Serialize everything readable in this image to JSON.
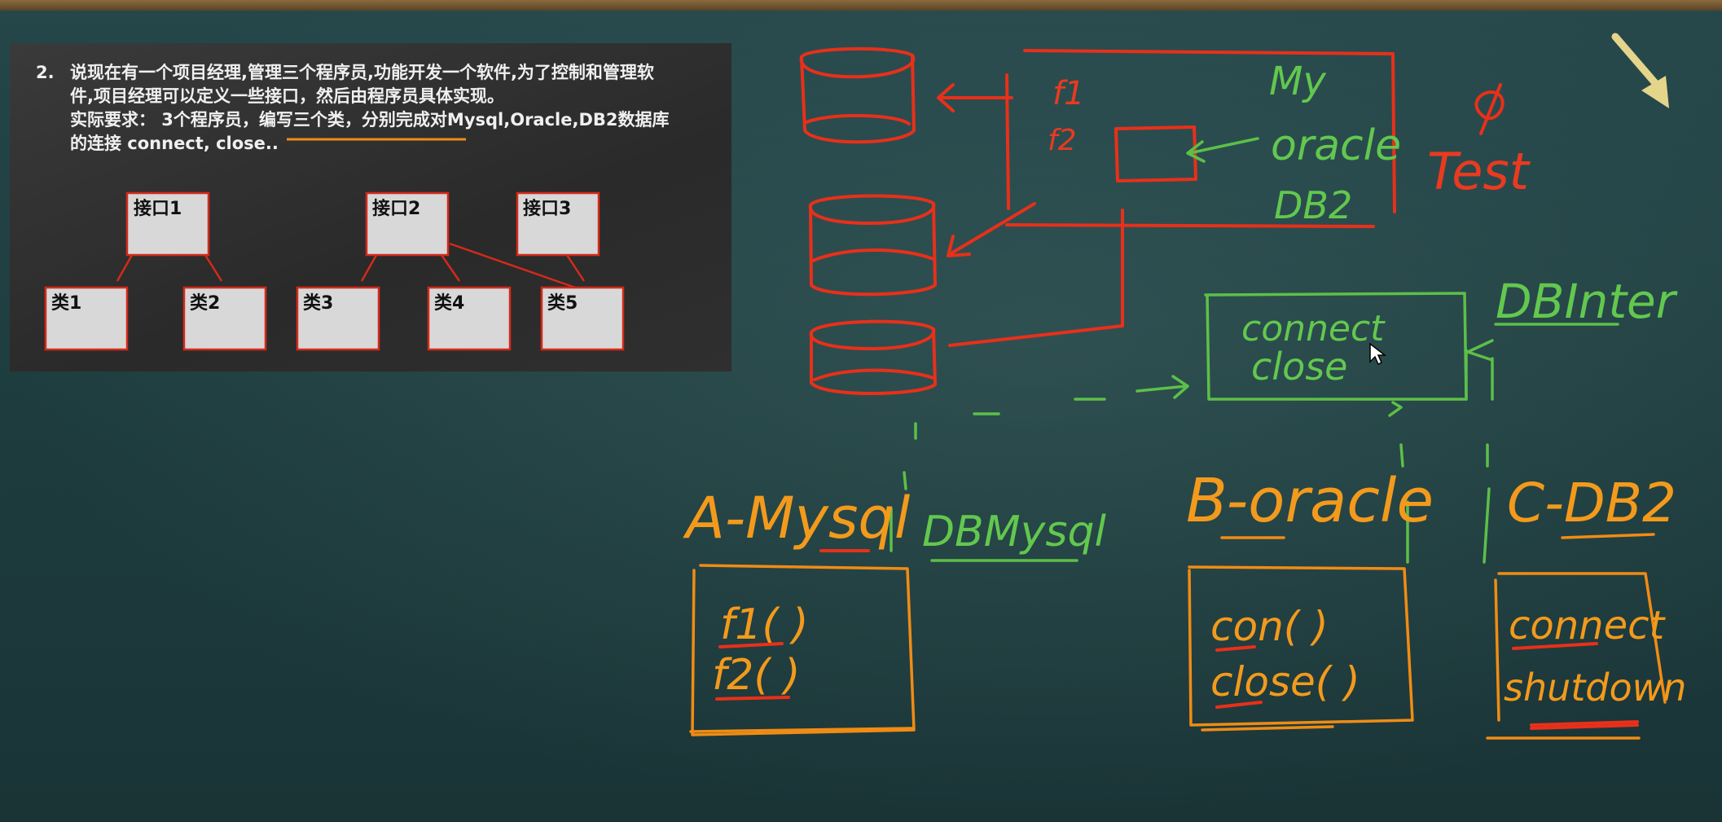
{
  "slide": {
    "number": "2.",
    "text_lines": [
      "说现在有一个项目经理,管理三个程序员,功能开发一个软件,为了控制和管理软",
      "件,项目经理可以定义一些接口，然后由程序员具体实现。",
      "实际要求： 3个程序员，编写三个类，分别完成对Mysql,Oracle,DB2数据库",
      "的连接 connect, close.."
    ],
    "interfaces": [
      "接口1",
      "接口2",
      "接口3"
    ],
    "classes": [
      "类1",
      "类2",
      "类3",
      "类4",
      "类5"
    ]
  },
  "chalkboard": {
    "top_box_words": [
      "f1",
      "f2",
      "My",
      "oracle",
      "DB2"
    ],
    "test_label": "Test",
    "interface_name": "DBInter",
    "interface_methods": [
      "connect",
      "close"
    ],
    "impl_green_label": "DBMysql",
    "classes": [
      {
        "name": "A-Mysql",
        "methods": [
          "f1( )",
          "f2( )"
        ]
      },
      {
        "name": "B-oracle",
        "methods": [
          "con( )",
          "close( )"
        ]
      },
      {
        "name": "C-DB2",
        "methods": [
          "connect",
          "shutdown"
        ]
      }
    ]
  },
  "colors": {
    "board": "#1f3a3c",
    "red_chalk": "#e8301a",
    "green_chalk": "#5cc048",
    "orange_chalk": "#f08c14",
    "slide_box_fill": "#d8d8d8",
    "slide_box_border": "#d42a1a"
  },
  "icons": [
    "nav-arrow-icon",
    "mouse-cursor-icon"
  ]
}
